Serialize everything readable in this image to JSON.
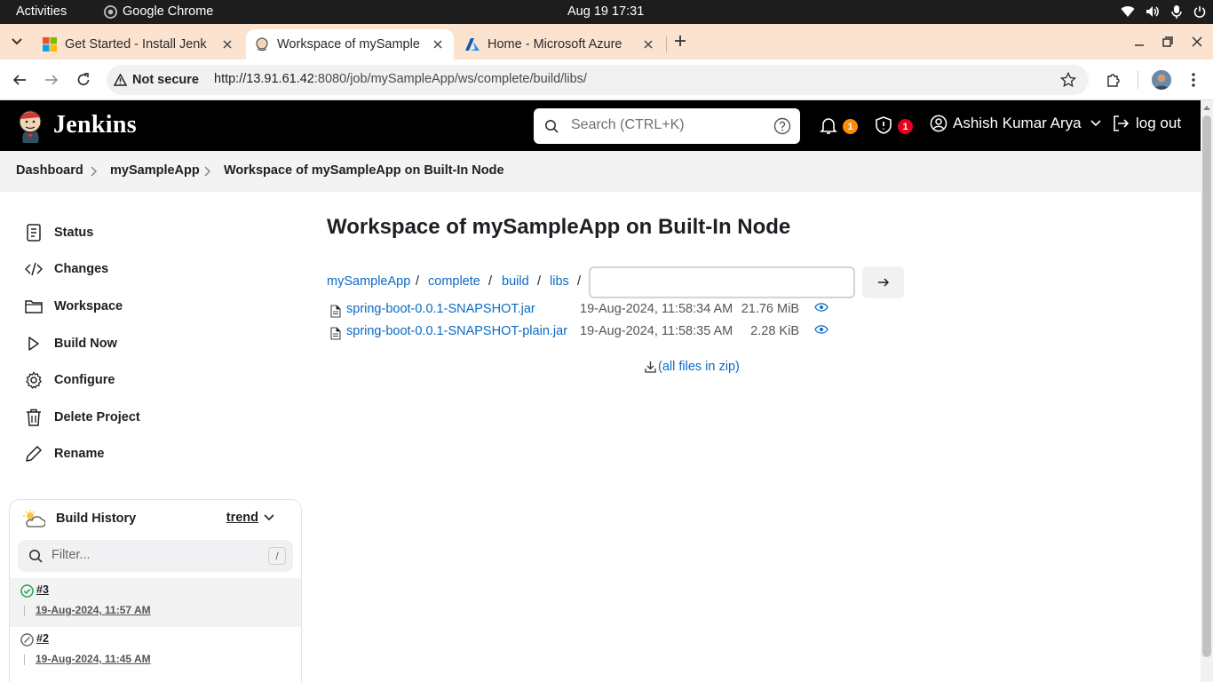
{
  "os": {
    "activities": "Activities",
    "app_name": "Google Chrome",
    "clock": "Aug 19  17:31"
  },
  "browser": {
    "tabs": [
      {
        "title": "Get Started - Install Jenk",
        "active": false
      },
      {
        "title": "Workspace of mySample",
        "active": true
      },
      {
        "title": "Home - Microsoft Azure",
        "active": false
      }
    ],
    "security_label": "Not secure",
    "url_host": "http://13.91.61.42",
    "url_rest": ":8080/job/mySampleApp/ws/complete/build/libs/"
  },
  "jenkins": {
    "brand": "Jenkins",
    "search_placeholder": "Search (CTRL+K)",
    "notifications_count": "1",
    "security_count": "1",
    "user_name": "Ashish Kumar Arya",
    "logout_label": "log out",
    "colors": {
      "notify": "#fe8c0a",
      "security": "#e6001f",
      "link": "#0b6ac4",
      "success": "#1ea64b"
    }
  },
  "breadcrumbs": [
    "Dashboard",
    "mySampleApp",
    "Workspace of mySampleApp on Built-In Node"
  ],
  "sidebar": {
    "items": [
      {
        "label": "Status",
        "icon": "document-icon"
      },
      {
        "label": "Changes",
        "icon": "code-icon"
      },
      {
        "label": "Workspace",
        "icon": "folder-icon"
      },
      {
        "label": "Build Now",
        "icon": "play-icon"
      },
      {
        "label": "Configure",
        "icon": "gear-icon"
      },
      {
        "label": "Delete Project",
        "icon": "trash-icon"
      },
      {
        "label": "Rename",
        "icon": "pencil-icon"
      }
    ]
  },
  "build_history": {
    "title": "Build History",
    "trend_label": "trend",
    "filter_placeholder": "Filter...",
    "filter_shortcut": "/",
    "builds": [
      {
        "number": "#3",
        "date": "19-Aug-2024, 11:57 AM",
        "status": "success"
      },
      {
        "number": "#2",
        "date": "19-Aug-2024, 11:45 AM",
        "status": "not-built"
      }
    ]
  },
  "main": {
    "title": "Workspace of mySampleApp on Built-In Node",
    "path": [
      "mySampleApp",
      "complete",
      "build",
      "libs"
    ],
    "path_separator": "/",
    "files": [
      {
        "name": "spring-boot-0.0.1-SNAPSHOT.jar",
        "date": "19-Aug-2024, 11:58:34 AM",
        "size": "21.76 MiB"
      },
      {
        "name": "spring-boot-0.0.1-SNAPSHOT-plain.jar",
        "date": "19-Aug-2024, 11:58:35 AM",
        "size": "2.28 KiB"
      }
    ],
    "zip_label": "(all files in zip)"
  }
}
